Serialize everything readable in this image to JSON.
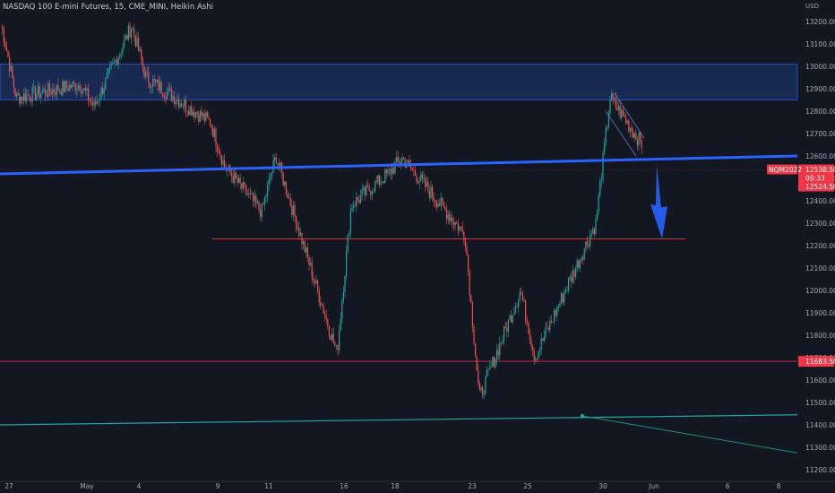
{
  "header": {
    "symbol_title": "NASDAQ 100 E-mini Futures, 15, CME_MINI, Heikin Ashi",
    "currency": "USD"
  },
  "colors": {
    "background": "#131722",
    "up_candle": "#26a69a",
    "down_candle": "#ef5350",
    "resistance_zone": "#1e3a78",
    "trendline_blue": "#2962ff",
    "support_line": "#f23645",
    "trendline_green": "#26a69a",
    "arrow_blue": "#2962ff",
    "price_label_bg": "#f23645"
  },
  "chart_data": {
    "type": "candlestick",
    "title": "NASDAQ 100 E-mini Futures, 15, CME_MINI, Heikin Ashi",
    "y_unit": "USD",
    "ylim": [
      11150,
      13320
    ],
    "y_ticks": [
      11200,
      11300,
      11400,
      11500,
      11600,
      11700,
      11800,
      11900,
      12000,
      12100,
      12200,
      12300,
      12400,
      12500,
      12600,
      12700,
      12800,
      12900,
      13000,
      13100,
      13200
    ],
    "x_ticks": [
      "27",
      "May",
      "4",
      "9",
      "11",
      "16",
      "18",
      "23",
      "25",
      "30",
      "Jun",
      "6",
      "8"
    ],
    "price_path": [
      [
        "27",
        13180
      ],
      [
        "27",
        12860
      ],
      [
        "May",
        12920
      ],
      [
        "May",
        12820
      ],
      [
        "4",
        13180
      ],
      [
        "4",
        12950
      ],
      [
        "9",
        12750
      ],
      [
        "9",
        12550
      ],
      [
        "11",
        12350
      ],
      [
        "11",
        12600
      ],
      [
        "16",
        11720
      ],
      [
        "16",
        12380
      ],
      [
        "18",
        12520
      ],
      [
        "18",
        12590
      ],
      [
        "23",
        12250
      ],
      [
        "23",
        11520
      ],
      [
        "25",
        12000
      ],
      [
        "25",
        11700
      ],
      [
        "30",
        12300
      ],
      [
        "30",
        12860
      ],
      [
        "Jun",
        12620
      ],
      [
        "Jun",
        12538
      ]
    ],
    "annotations": {
      "resistance_zone": [
        12850,
        13010
      ],
      "support_line_upper": 12230,
      "support_line_lower": 11683.5,
      "blue_trendline": [
        12520,
        12600
      ],
      "green_trendline": [
        11400,
        11445
      ],
      "arrow": "down",
      "current_price": "12538.50",
      "countdown": "09:33",
      "secondary_price": "12524.50",
      "contract_label": "NQM2022",
      "support_price_label": "11683.50"
    }
  }
}
